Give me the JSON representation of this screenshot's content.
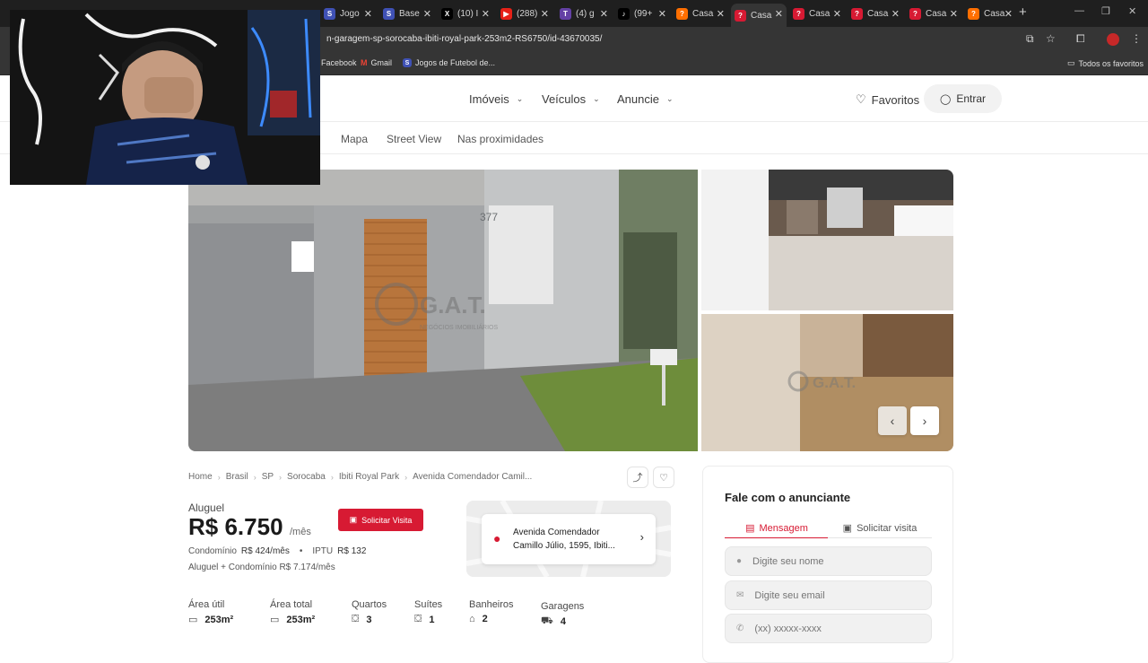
{
  "browser": {
    "tabs": [
      {
        "label": "Jogo",
        "color": "#3f51b5",
        "glyph": "S"
      },
      {
        "label": "Base",
        "color": "#3f51b5",
        "glyph": "S"
      },
      {
        "label": "(10) I",
        "color": "#000000",
        "glyph": "X"
      },
      {
        "label": "(288)",
        "color": "#e62117",
        "glyph": "▶"
      },
      {
        "label": "(4) g",
        "color": "#6441a5",
        "glyph": "T"
      },
      {
        "label": "(99+",
        "color": "#000000",
        "glyph": "♪"
      },
      {
        "label": "Casa",
        "color": "#ff6f00",
        "glyph": "?"
      },
      {
        "label": "Casa",
        "color": "#d71a33",
        "glyph": "?"
      },
      {
        "label": "Casa",
        "color": "#d71a33",
        "glyph": "?"
      },
      {
        "label": "Casa",
        "color": "#d71a33",
        "glyph": "?"
      },
      {
        "label": "Casa",
        "color": "#d71a33",
        "glyph": "?"
      },
      {
        "label": "Casa",
        "color": "#ff6f00",
        "glyph": "?"
      }
    ],
    "url": "n-garagem-sp-sorocaba-ibiti-royal-park-253m2-RS6750/id-43670035/",
    "bookmarks": {
      "facebook": "Facebook",
      "gmail": "Gmail",
      "futebol": "Jogos de Futebol de...",
      "all": "Todos os favoritos"
    }
  },
  "header": {
    "nav": {
      "imoveis": "Imóveis",
      "veiculos": "Veículos",
      "anuncie": "Anuncie"
    },
    "favoritos": "Favoritos",
    "entrar": "Entrar"
  },
  "subnav": {
    "mapa": "Mapa",
    "street_view": "Street View",
    "proximidades": "Nas proximidades"
  },
  "gallery": {
    "watermark": "G.A.T.",
    "watermark_sub": "NEGÓCIOS IMOBILIÁRIOS",
    "house_number": "377"
  },
  "breadcrumb": [
    "Home",
    "Brasil",
    "SP",
    "Sorocaba",
    "Ibiti Royal Park",
    "Avenida Comendador Camil..."
  ],
  "listing": {
    "tipo": "Aluguel",
    "price": "R$ 6.750",
    "price_unit": "/mês",
    "visit_button": "Solicitar Visita",
    "condominio_label": "Condomínio",
    "condominio_value": "R$ 424/mês",
    "iptu_label": "IPTU",
    "iptu_value": "R$ 132",
    "total": "Aluguel + Condomínio R$ 7.174/mês",
    "address": "Avenida Comendador Camillo Júlio, 1595, Ibiti..."
  },
  "features": [
    {
      "label": "Área útil",
      "value": "253m²",
      "icon": "ruler-icon",
      "glyph": "▭"
    },
    {
      "label": "Área total",
      "value": "253m²",
      "icon": "ruler-icon",
      "glyph": "▭"
    },
    {
      "label": "Quartos",
      "value": "3",
      "icon": "bed-icon",
      "glyph": "⛋"
    },
    {
      "label": "Suítes",
      "value": "1",
      "icon": "bed-icon",
      "glyph": "⛋"
    },
    {
      "label": "Banheiros",
      "value": "2",
      "icon": "shower-icon",
      "glyph": "⌂"
    },
    {
      "label": "Garagens",
      "value": "4",
      "icon": "car-icon",
      "glyph": "⛟"
    }
  ],
  "contact": {
    "title": "Fale com o anunciante",
    "tab_message": "Mensagem",
    "tab_visit": "Solicitar visita",
    "name_placeholder": "Digite seu nome",
    "email_placeholder": "Digite seu email",
    "phone_placeholder": "(xx) xxxxx-xxxx"
  },
  "colors": {
    "brand": "#d71a33",
    "chrome": "#1f1f1f"
  }
}
